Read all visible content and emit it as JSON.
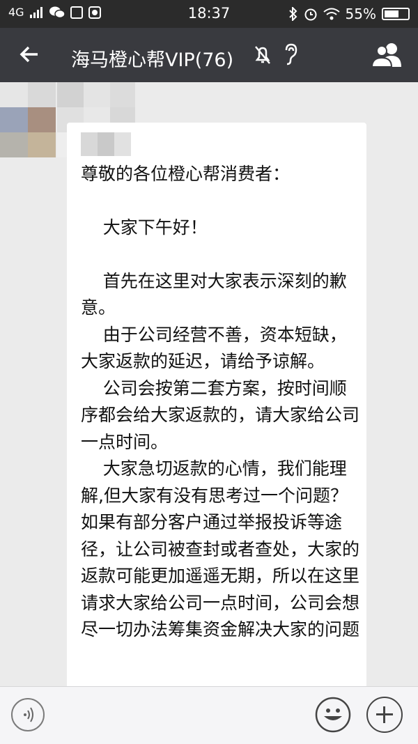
{
  "status_bar": {
    "network": "4G",
    "time": "18:37",
    "battery": "55%",
    "battery_level": 0.55
  },
  "header": {
    "title": "海马橙心帮VIP(76)",
    "back_icon": "back-arrow-icon",
    "mute_icon": "muted-bell-icon",
    "earpiece_icon": "earpiece-icon",
    "members_icon": "group-members-icon"
  },
  "colors": {
    "status_bar_bg": "#2b2b2b",
    "title_bar_bg": "#393a3f",
    "chat_bg": "#ebebeb",
    "bubble_bg": "#ffffff"
  },
  "message": {
    "text": "人\n尊敬的各位橙心帮消费者：\n\n    大家下午好！\n\n    首先在这里对大家表示深刻的歉意。\n    由于公司经营不善，资本短缺，大家返款的延迟，请给予谅解。\n    公司会按第二套方案，按时间顺序都会给大家返款的，请大家给公司一点时间。\n    大家急切返款的心情，我们能理解,但大家有没有思考过一个问题？如果有部分客户通过举报投诉等途径，让公司被查封或者查处，大家的返款可能更加遥遥无期，所以在这里请求大家给公司一点时间，公司会想尽一切办法筹集资金解决大家的问题"
  },
  "input_bar": {
    "voice_icon": "voice-icon",
    "emoji_icon": "emoji-icon",
    "plus_icon": "plus-icon"
  }
}
